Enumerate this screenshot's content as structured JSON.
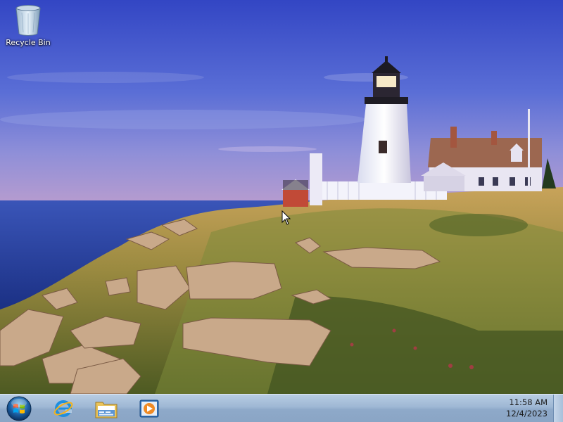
{
  "desktop": {
    "icons": [
      {
        "label": "Recycle Bin",
        "icon": "recycle-bin-icon"
      }
    ]
  },
  "taskbar": {
    "start_icon": "windows-orb-icon",
    "pinned": [
      {
        "icon": "internet-explorer-icon"
      },
      {
        "icon": "windows-explorer-icon"
      },
      {
        "icon": "media-player-icon"
      }
    ],
    "clock": {
      "time": "11:58 AM",
      "date": "12/4/2023"
    }
  },
  "colors": {
    "sky_top": "#3a4fc9",
    "sea": "#1f3f9a",
    "taskbar": "#9eb7d4"
  }
}
